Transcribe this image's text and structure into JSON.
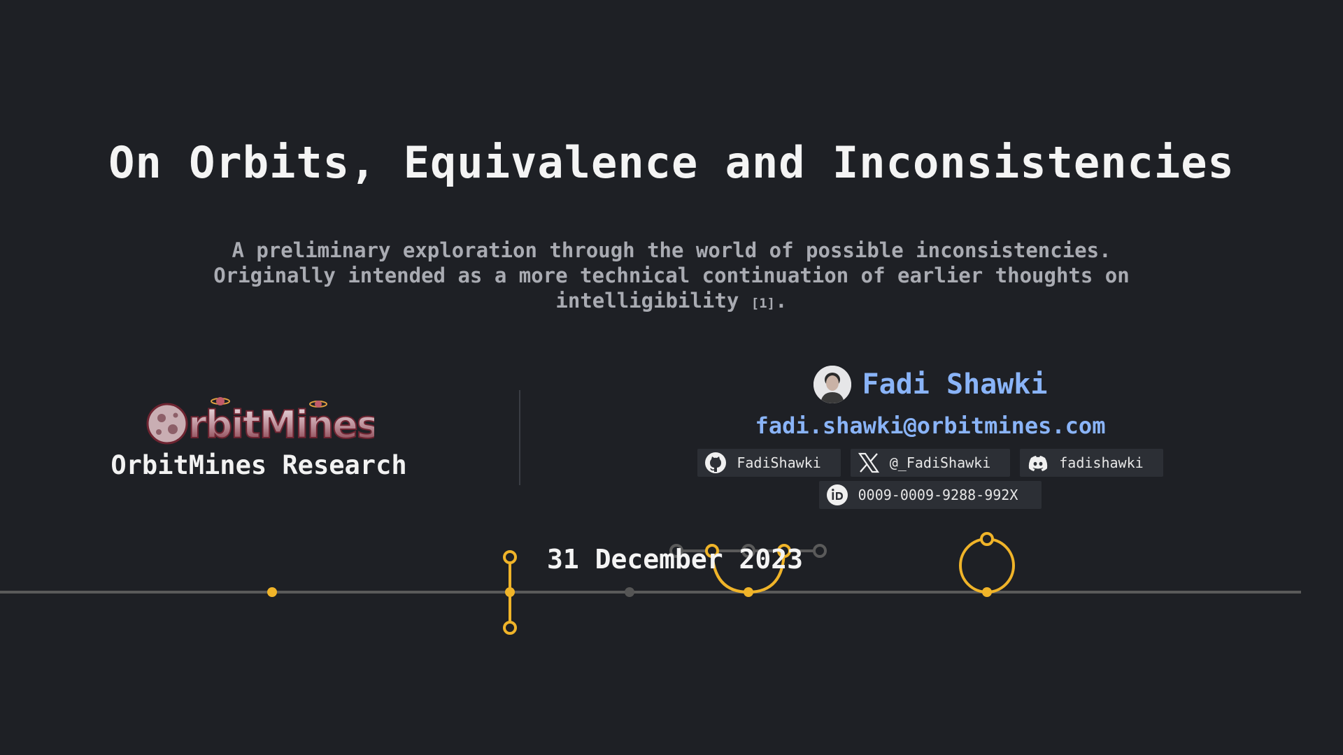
{
  "title": "On Orbits, Equivalence and Inconsistencies",
  "subtitle": {
    "line1": "A preliminary exploration through the world of possible inconsistencies.",
    "line2": "Originally intended as a more technical continuation of earlier thoughts on",
    "line3_text": "intelligibility",
    "reference": "[1]",
    "line3_end": "."
  },
  "organization": {
    "logo_text": "OrbitMines",
    "name": "OrbitMines Research"
  },
  "author": {
    "name": "Fadi Shawki",
    "email": "fadi.shawki@orbitmines.com",
    "socials": [
      {
        "icon": "github-icon",
        "label": "FadiShawki"
      },
      {
        "icon": "x-icon",
        "label": "@_FadiShawki"
      },
      {
        "icon": "discord-icon",
        "label": "fadishawki"
      },
      {
        "icon": "orcid-icon",
        "label": "0009-0009-9288-992X"
      }
    ]
  },
  "date": "31 December 2023",
  "colors": {
    "background": "#1e2025",
    "accent": "#f0b429",
    "link": "#8ab4f8",
    "timeline": "#5a5a5a"
  }
}
